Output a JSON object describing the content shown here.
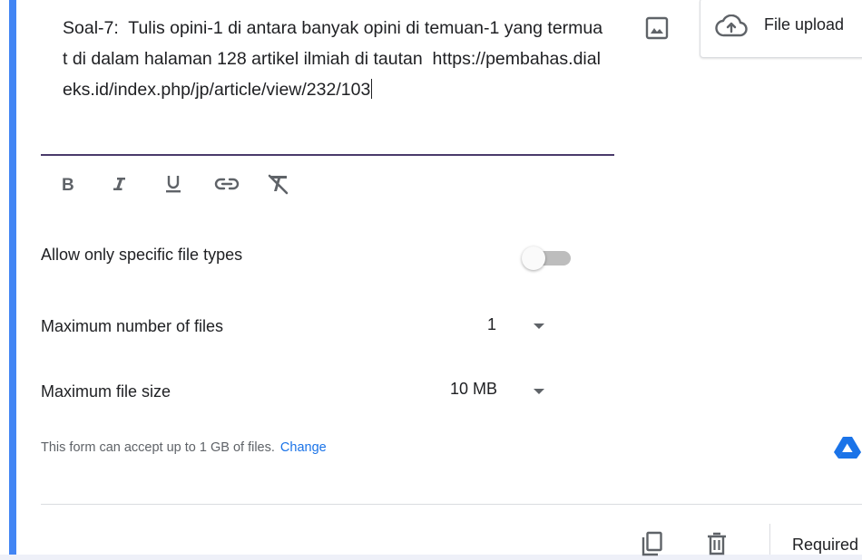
{
  "question": {
    "text": "Soal-7:  Tulis opini-1 di antara banyak opini di temuan-1 yang termuat di dalam halaman 128 artikel ilmiah di tautan  https://pembahas.dialeks.id/index.php/jp/article/view/232/103"
  },
  "toolbar": {
    "bold_icon": "bold-icon",
    "italic_icon": "italic-icon",
    "underline_icon": "underline-icon",
    "link_icon": "link-icon",
    "clear_format_icon": "clear-formatting-icon"
  },
  "question_type": {
    "label": "File upload",
    "icon": "cloud-upload-icon"
  },
  "side_icons": {
    "image": "image-icon",
    "drive": "google-drive-icon"
  },
  "settings": {
    "allow_specific_types": {
      "label": "Allow only specific file types",
      "enabled": false
    },
    "max_files": {
      "label": "Maximum number of files",
      "value": "1"
    },
    "max_size": {
      "label": "Maximum file size",
      "value": "10 MB"
    }
  },
  "note": {
    "text": "This form can accept up to 1 GB of files.",
    "link": "Change"
  },
  "footer": {
    "duplicate_icon": "copy-icon",
    "delete_icon": "trash-icon",
    "required_label": "Required"
  },
  "colors": {
    "accent": "#4285f4",
    "link": "#1a73e8",
    "active_underline": "#4a3a6a",
    "toggle_off": "#bdbdbd"
  }
}
